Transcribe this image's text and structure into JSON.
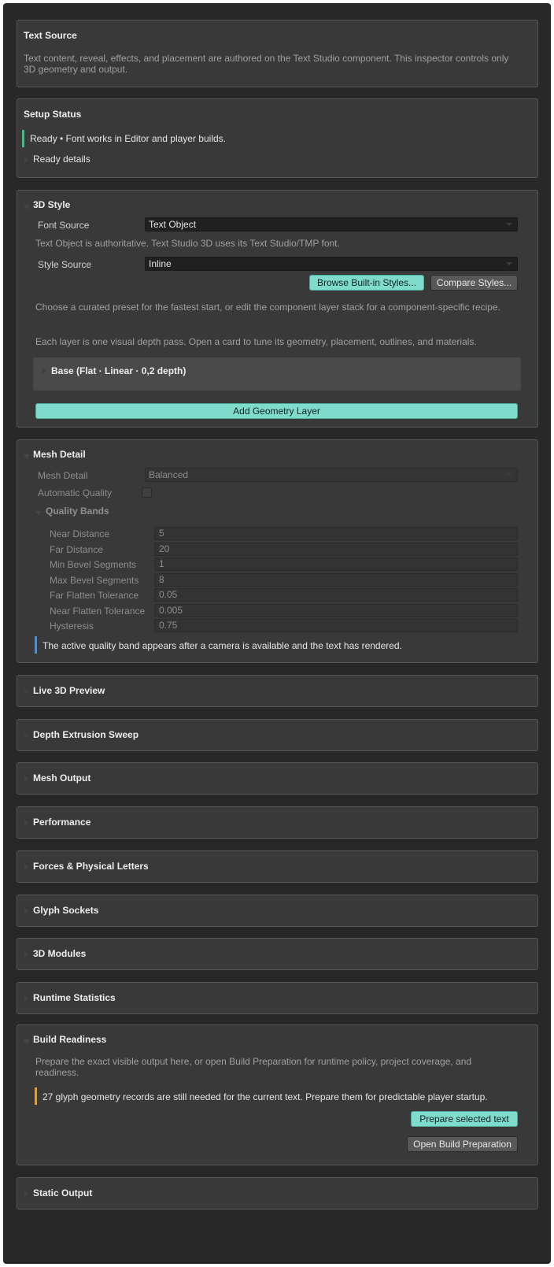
{
  "text_source": {
    "title": "Text Source",
    "description": "Text content, reveal, effects, and placement are authored on the Text Studio component. This inspector controls only 3D geometry and output."
  },
  "setup_status": {
    "title": "Setup Status",
    "message": "Ready • Font works in Editor and player builds.",
    "details_label": "Ready details",
    "status_color": "#3fbf8a"
  },
  "style_3d": {
    "title": "3D Style",
    "font_source_label": "Font Source",
    "font_source_value": "Text Object",
    "font_source_help": "Text Object is authoritative. Text Studio 3D uses its Text Studio/TMP font.",
    "style_source_label": "Style Source",
    "style_source_value": "Inline",
    "browse_button": "Browse Built-in Styles...",
    "compare_button": "Compare Styles...",
    "help_1": "Choose a curated preset for the fastest start, or edit the component layer stack for a component-specific recipe.",
    "help_2": "Each layer is one visual depth pass. Open a card to tune its geometry, placement, outlines, and materials.",
    "layer_title": "Base (Flat · Linear · 0,2 depth)",
    "add_layer_button": "Add Geometry Layer"
  },
  "mesh_detail": {
    "title": "Mesh Detail",
    "mesh_detail_label": "Mesh Detail",
    "mesh_detail_value": "Balanced",
    "auto_quality_label": "Automatic Quality",
    "auto_quality_checked": false,
    "quality_bands_title": "Quality Bands",
    "fields": [
      {
        "label": "Near Distance",
        "value": "5"
      },
      {
        "label": "Far Distance",
        "value": "20"
      },
      {
        "label": "Min Bevel Segments",
        "value": "1"
      },
      {
        "label": "Max Bevel Segments",
        "value": "8"
      },
      {
        "label": "Far Flatten Tolerance",
        "value": "0.05"
      },
      {
        "label": "Near Flatten Tolerance",
        "value": "0.005"
      },
      {
        "label": "Hysteresis",
        "value": "0.75"
      }
    ],
    "info_message": "The active quality band appears after a camera is available and the text has rendered.",
    "info_color": "#4a90d9"
  },
  "collapsed_sections": [
    {
      "title": "Live 3D Preview"
    },
    {
      "title": "Depth Extrusion Sweep"
    },
    {
      "title": "Mesh Output"
    },
    {
      "title": "Performance"
    },
    {
      "title": "Forces & Physical Letters"
    },
    {
      "title": "Glyph Sockets"
    },
    {
      "title": "3D Modules"
    },
    {
      "title": "Runtime Statistics"
    }
  ],
  "build_readiness": {
    "title": "Build Readiness",
    "description": "Prepare the exact visible output here, or open Build Preparation for runtime policy, project coverage, and readiness.",
    "warning": "27 glyph geometry records are still needed for the current text. Prepare them for predictable player startup.",
    "warning_color": "#e0a030",
    "prepare_button": "Prepare selected text",
    "open_button": "Open Build Preparation"
  },
  "static_output": {
    "title": "Static Output"
  },
  "colors": {
    "accent": "#7fdccd",
    "panel": "#393939",
    "background": "#282828"
  }
}
